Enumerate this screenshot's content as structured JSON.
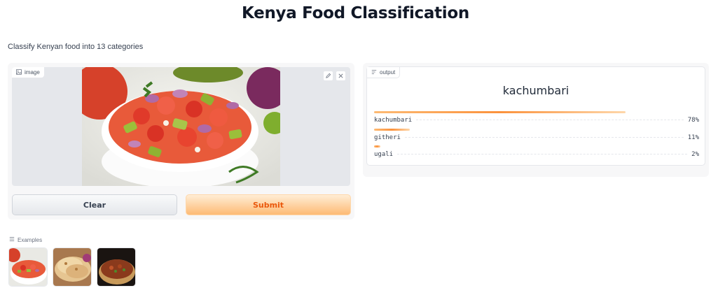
{
  "app": {
    "title": "Kenya Food Classification",
    "description": "Classify Kenyan food into 13 categories"
  },
  "input": {
    "label": "image",
    "icons": [
      "edit-icon",
      "close-icon"
    ],
    "image_semantic": "kachumbari salad in white bowl"
  },
  "buttons": {
    "clear": "Clear",
    "submit": "Submit"
  },
  "output": {
    "label": "output",
    "top_prediction": "kachumbari",
    "confidences": [
      {
        "label": "kachumbari",
        "value": 0.78,
        "display": "78%"
      },
      {
        "label": "githeri",
        "value": 0.11,
        "display": "11%"
      },
      {
        "label": "ugali",
        "value": 0.02,
        "display": "2%"
      }
    ]
  },
  "examples": {
    "label": "Examples",
    "items": [
      "kachumbari example",
      "chapati example",
      "stew example"
    ]
  },
  "colors": {
    "accent": "#f97316",
    "submit_text": "#ea580c"
  }
}
